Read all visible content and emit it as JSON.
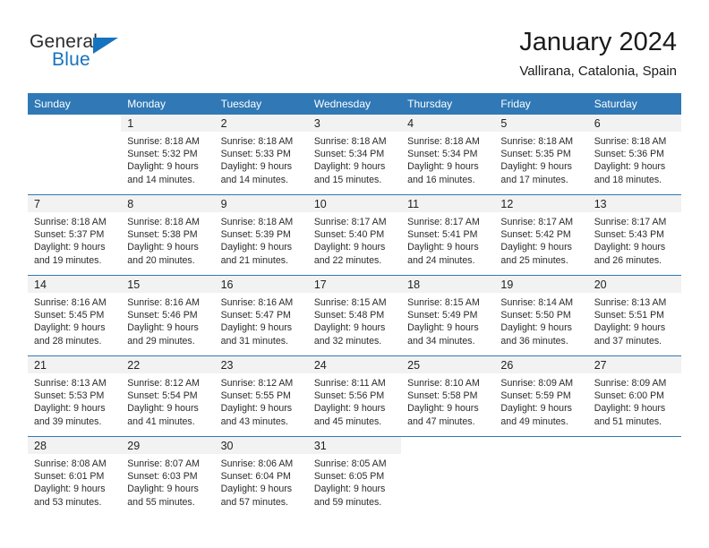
{
  "brand": {
    "name_top": "General",
    "name_bottom": "Blue",
    "accent_color": "#1573bf"
  },
  "header": {
    "title": "January 2024",
    "subtitle": "Vallirana, Catalonia, Spain"
  },
  "theme": {
    "header_row_color": "#3079b6",
    "daynum_bar_color": "#f2f2f2",
    "divider_color": "#3079b6",
    "text_color": "#222222"
  },
  "weekday_headers": [
    "Sunday",
    "Monday",
    "Tuesday",
    "Wednesday",
    "Thursday",
    "Friday",
    "Saturday"
  ],
  "weeks": [
    [
      {
        "day": "",
        "blank": true,
        "lines": []
      },
      {
        "day": "1",
        "lines": [
          "Sunrise: 8:18 AM",
          "Sunset: 5:32 PM",
          "Daylight: 9 hours",
          "and 14 minutes."
        ]
      },
      {
        "day": "2",
        "lines": [
          "Sunrise: 8:18 AM",
          "Sunset: 5:33 PM",
          "Daylight: 9 hours",
          "and 14 minutes."
        ]
      },
      {
        "day": "3",
        "lines": [
          "Sunrise: 8:18 AM",
          "Sunset: 5:34 PM",
          "Daylight: 9 hours",
          "and 15 minutes."
        ]
      },
      {
        "day": "4",
        "lines": [
          "Sunrise: 8:18 AM",
          "Sunset: 5:34 PM",
          "Daylight: 9 hours",
          "and 16 minutes."
        ]
      },
      {
        "day": "5",
        "lines": [
          "Sunrise: 8:18 AM",
          "Sunset: 5:35 PM",
          "Daylight: 9 hours",
          "and 17 minutes."
        ]
      },
      {
        "day": "6",
        "lines": [
          "Sunrise: 8:18 AM",
          "Sunset: 5:36 PM",
          "Daylight: 9 hours",
          "and 18 minutes."
        ]
      }
    ],
    [
      {
        "day": "7",
        "lines": [
          "Sunrise: 8:18 AM",
          "Sunset: 5:37 PM",
          "Daylight: 9 hours",
          "and 19 minutes."
        ]
      },
      {
        "day": "8",
        "lines": [
          "Sunrise: 8:18 AM",
          "Sunset: 5:38 PM",
          "Daylight: 9 hours",
          "and 20 minutes."
        ]
      },
      {
        "day": "9",
        "lines": [
          "Sunrise: 8:18 AM",
          "Sunset: 5:39 PM",
          "Daylight: 9 hours",
          "and 21 minutes."
        ]
      },
      {
        "day": "10",
        "lines": [
          "Sunrise: 8:17 AM",
          "Sunset: 5:40 PM",
          "Daylight: 9 hours",
          "and 22 minutes."
        ]
      },
      {
        "day": "11",
        "lines": [
          "Sunrise: 8:17 AM",
          "Sunset: 5:41 PM",
          "Daylight: 9 hours",
          "and 24 minutes."
        ]
      },
      {
        "day": "12",
        "lines": [
          "Sunrise: 8:17 AM",
          "Sunset: 5:42 PM",
          "Daylight: 9 hours",
          "and 25 minutes."
        ]
      },
      {
        "day": "13",
        "lines": [
          "Sunrise: 8:17 AM",
          "Sunset: 5:43 PM",
          "Daylight: 9 hours",
          "and 26 minutes."
        ]
      }
    ],
    [
      {
        "day": "14",
        "lines": [
          "Sunrise: 8:16 AM",
          "Sunset: 5:45 PM",
          "Daylight: 9 hours",
          "and 28 minutes."
        ]
      },
      {
        "day": "15",
        "lines": [
          "Sunrise: 8:16 AM",
          "Sunset: 5:46 PM",
          "Daylight: 9 hours",
          "and 29 minutes."
        ]
      },
      {
        "day": "16",
        "lines": [
          "Sunrise: 8:16 AM",
          "Sunset: 5:47 PM",
          "Daylight: 9 hours",
          "and 31 minutes."
        ]
      },
      {
        "day": "17",
        "lines": [
          "Sunrise: 8:15 AM",
          "Sunset: 5:48 PM",
          "Daylight: 9 hours",
          "and 32 minutes."
        ]
      },
      {
        "day": "18",
        "lines": [
          "Sunrise: 8:15 AM",
          "Sunset: 5:49 PM",
          "Daylight: 9 hours",
          "and 34 minutes."
        ]
      },
      {
        "day": "19",
        "lines": [
          "Sunrise: 8:14 AM",
          "Sunset: 5:50 PM",
          "Daylight: 9 hours",
          "and 36 minutes."
        ]
      },
      {
        "day": "20",
        "lines": [
          "Sunrise: 8:13 AM",
          "Sunset: 5:51 PM",
          "Daylight: 9 hours",
          "and 37 minutes."
        ]
      }
    ],
    [
      {
        "day": "21",
        "lines": [
          "Sunrise: 8:13 AM",
          "Sunset: 5:53 PM",
          "Daylight: 9 hours",
          "and 39 minutes."
        ]
      },
      {
        "day": "22",
        "lines": [
          "Sunrise: 8:12 AM",
          "Sunset: 5:54 PM",
          "Daylight: 9 hours",
          "and 41 minutes."
        ]
      },
      {
        "day": "23",
        "lines": [
          "Sunrise: 8:12 AM",
          "Sunset: 5:55 PM",
          "Daylight: 9 hours",
          "and 43 minutes."
        ]
      },
      {
        "day": "24",
        "lines": [
          "Sunrise: 8:11 AM",
          "Sunset: 5:56 PM",
          "Daylight: 9 hours",
          "and 45 minutes."
        ]
      },
      {
        "day": "25",
        "lines": [
          "Sunrise: 8:10 AM",
          "Sunset: 5:58 PM",
          "Daylight: 9 hours",
          "and 47 minutes."
        ]
      },
      {
        "day": "26",
        "lines": [
          "Sunrise: 8:09 AM",
          "Sunset: 5:59 PM",
          "Daylight: 9 hours",
          "and 49 minutes."
        ]
      },
      {
        "day": "27",
        "lines": [
          "Sunrise: 8:09 AM",
          "Sunset: 6:00 PM",
          "Daylight: 9 hours",
          "and 51 minutes."
        ]
      }
    ],
    [
      {
        "day": "28",
        "lines": [
          "Sunrise: 8:08 AM",
          "Sunset: 6:01 PM",
          "Daylight: 9 hours",
          "and 53 minutes."
        ]
      },
      {
        "day": "29",
        "lines": [
          "Sunrise: 8:07 AM",
          "Sunset: 6:03 PM",
          "Daylight: 9 hours",
          "and 55 minutes."
        ]
      },
      {
        "day": "30",
        "lines": [
          "Sunrise: 8:06 AM",
          "Sunset: 6:04 PM",
          "Daylight: 9 hours",
          "and 57 minutes."
        ]
      },
      {
        "day": "31",
        "lines": [
          "Sunrise: 8:05 AM",
          "Sunset: 6:05 PM",
          "Daylight: 9 hours",
          "and 59 minutes."
        ]
      },
      {
        "day": "",
        "blank": true,
        "lines": []
      },
      {
        "day": "",
        "blank": true,
        "lines": []
      },
      {
        "day": "",
        "blank": true,
        "lines": []
      }
    ]
  ]
}
